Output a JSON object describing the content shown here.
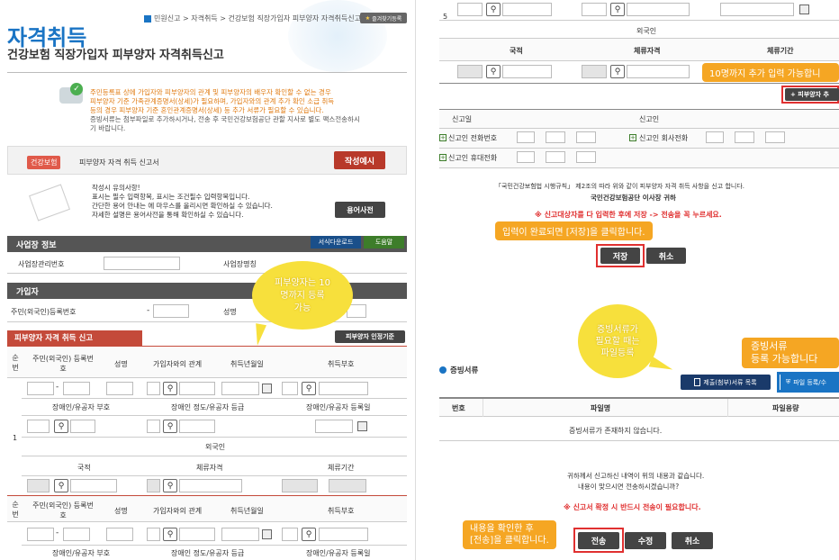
{
  "left": {
    "header": {
      "home_icon": "home-icon",
      "breadcrumb": "민원신고 > 자격취득 > 건강보험 직장가입자 피부양자 자격취득신고",
      "favorite_label": "즐겨찾기등록",
      "title": "자격취득",
      "subtitle": "건강보험 직장가입자 피부양자 자격취득신고"
    },
    "notice": {
      "line1": "주민등록표 상에 가입자와 피부양자의 관계 및 피부양자의 배우자 확인할 수 없는 경우",
      "line2": "피부양자 기준 가족관계증명서(상세)가 필요하며, 가입자와의 관계 추가 확인 소급 취득",
      "line3": "등의 경우 피부양자 기준 혼인관계증명서(상세) 등 추가 서류가 필요할 수 있습니다.",
      "line4": "증빙서류는 첨부파일로 추가하시거나, 전송 후 국민건강보험공단 관할 지사로 별도 팩스전송하시",
      "line5": "기 바랍니다."
    },
    "form_bar": {
      "badge": "건강보험",
      "form_name": "피부양자 자격 취득 신고서",
      "example_button": "작성예시"
    },
    "guide": {
      "title": "작성시 유의사항!",
      "line1": "표시는 필수 입력항목, 표시는 조건필수 입력항목입니다.",
      "line2": "간단한 용어 안내는 에 마우스를 올리시면 확인하실 수 있습니다.",
      "line3": "자세한 설명은 용어사전을 통해 확인하실 수 있습니다.",
      "dict_button": "용어사전"
    },
    "biz": {
      "section": "사업장 정보",
      "download_button": "서식다운로드",
      "help_button": "도움말",
      "mgmt_label": "사업장관리번호",
      "name_label": "사업장명칭"
    },
    "subscriber": {
      "section": "가입자",
      "id_label": "주민(외국인)등록번호",
      "id_dash": "-",
      "name_label": "성명"
    },
    "dependent": {
      "section": "피부양자 자격 취득 신고",
      "criteria_button": "피부양자 인정기준",
      "col_seq": "순번",
      "col_id": "주민(외국인) 등록번호",
      "col_name": "성명",
      "col_rel": "가입자와의 관계",
      "col_date": "취득년월일",
      "col_code": "취득부호",
      "dis_type": "장애인/유공자 부호",
      "dis_grade": "장애인 정도/유공자 등급",
      "dis_date": "장애인/유공자 등록일",
      "foreigner": "외국인",
      "nationality": "국적",
      "stay": "체류자격",
      "stay_period": "체류기간",
      "row1": "1",
      "dash": "-"
    },
    "bubble": {
      "line1": "피부양자는 10",
      "line2": "명까지 등록",
      "line3": "가능"
    }
  },
  "right": {
    "row_num": "5",
    "foreigner": "외국인",
    "nationality": "국적",
    "stay": "체류자격",
    "stay_period": "체류기간",
    "callout_add": "10명까지 추가 입력 가능합니",
    "add_button": "+ 피부양자 추",
    "report_date": "신고일",
    "reporter": "신고인",
    "phone": "신고인 전화번호",
    "office_phone": "신고인 회사전화",
    "mobile": "신고인 휴대전화",
    "law_text": "「국민건강보험법 시행규칙」 제2조의 따라 위와 같이 피부양자 자격 취득 사항을 신고 합니다.",
    "to_text": "국민건강보험공단 이사장 귀하",
    "warn1": "※ 신고대상자를 다 입력한 후에 저장 -> 전송을 꼭 누르세요.",
    "callout_save": "입력이 완료되면 [저장]을 클릭합니다.",
    "save_button": "저장",
    "cancel_button": "취소",
    "bubble_line1": "증빙서류가",
    "bubble_line2": "필요할 때는",
    "bubble_line3": "파일등록",
    "callout_doc1": "증빙서류",
    "callout_doc2": "등록 가능합니다",
    "doc_section": "증빙서류",
    "submit_list_button": "제출(첨부)서류 목록",
    "file_reg_button": "파일 등록/수",
    "col_num": "번호",
    "col_file": "파일명",
    "col_size": "파일용량",
    "no_docs": "증빙서류가 존재하지 않습니다.",
    "confirm1": "귀하께서 신고하신 내역이 위의 내용과 같습니다.",
    "confirm2": "내용이 맞으시면 전송하시겠습니까?",
    "warn2": "※ 신고서 확정 시 반드시 전송이 필요합니다.",
    "callout_send1": "내용을 확인한 후",
    "callout_send2": "[전송]을 클릭합니다.",
    "send_button": "전송",
    "edit_button": "수정",
    "cancel2_button": "취소"
  },
  "colors": {
    "accent_blue": "#1a74c4",
    "red": "#d93a2b",
    "orange": "#f5a623",
    "yellow_bubble": "#f7e03c"
  }
}
